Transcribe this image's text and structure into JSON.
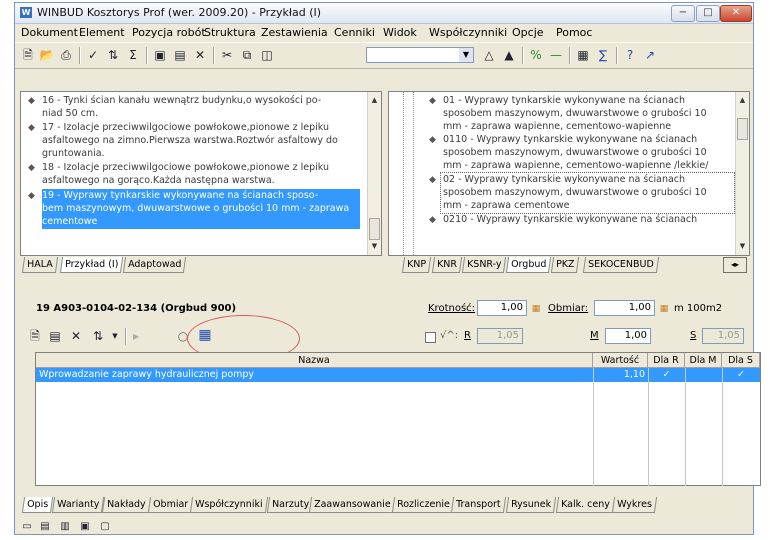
{
  "app": {
    "title": "WINBUD Kosztorys Prof (wer. 2009.20) - Przykład (I)"
  },
  "menu": [
    "Dokument",
    "Element",
    "Pozycja robót",
    "Struktura",
    "Zestawienia",
    "Cenniki",
    "Widok",
    "Współczynniki",
    "Opcje",
    "Pomoc"
  ],
  "window_controls": {
    "minimize": "−",
    "maximize": "□",
    "close": "✕"
  },
  "toolbar_icons": [
    "new-icon",
    "open-icon",
    "print-icon",
    "check-icon",
    "sort-icon",
    "sum-icon",
    "insert-icon",
    "insert-below-icon",
    "delete-icon",
    "cut-icon",
    "copy-icon",
    "paste-icon",
    "combo",
    "binoculars-icon",
    "find-next-icon",
    "percent-icon",
    "minus-icon",
    "report-icon",
    "bold-icon",
    "help-icon",
    "whatsthis-icon"
  ],
  "left_tree": {
    "items": [
      {
        "text": "16 - Tynki ścian kanału wewnątrz budynku,o wysokości po-"
      },
      {
        "text": "niad 50 cm."
      },
      {
        "text": "17 - Izolacje przeciwwilgociowe powłokowe,pionowe z lepiku"
      },
      {
        "text": "asfaltowego na zimno.Pierwsza warstwa.Roztwór asfaltowy do"
      },
      {
        "text": "gruntowania."
      },
      {
        "text": "18 - Izolacje przeciwwilgociowe powłokowe,pionowe z lepiku"
      },
      {
        "text": "asfaltowego na gorąco.Każda następna warstwa."
      },
      {
        "text": "19 - Wyprawy tynkarskie wykonywane na ścianach sposo-"
      },
      {
        "text": "bem maszynowym, dwuwarstwowe o grubości 10 mm - zaprawa"
      },
      {
        "text": "cementowe"
      }
    ],
    "tabs": [
      "HALA",
      "Przykład (I)",
      "Adaptowad"
    ]
  },
  "right_tree": {
    "items": [
      {
        "text": "01 - Wyprawy tynkarskie wykonywane na ścianach"
      },
      {
        "text": "sposobem maszynowym, dwuwarstwowe o grubości 10"
      },
      {
        "text": "mm - zaprawa wapienne, cementowo-wapienne"
      },
      {
        "text": "0110 - Wyprawy tynkarskie wykonywane na ścianach"
      },
      {
        "text": "sposobem maszynowym, dwuwarstwowe o grubości 10"
      },
      {
        "text": "mm - zaprawa wapienne, cementowo-wapienne /lekkie/"
      },
      {
        "text": "02 - Wyprawy tynkarskie wykonywane na ścianach"
      },
      {
        "text": "sposobem maszynowym, dwuwarstwowe o grubości 10"
      },
      {
        "text": "mm - zaprawa cementowe"
      },
      {
        "text": "0210 - Wyprawy tynkarskie wykonywane na ścianach"
      }
    ],
    "tabs": [
      "KNP",
      "KNR",
      "KSNR-y",
      "Orgbud",
      "PKZ",
      "SEKOCENBUD"
    ],
    "nav_button": "◂▸"
  },
  "position": {
    "line": "19  A903-0104-02-134  (Orgbud 900)",
    "krotnosc_label": "Krotność:",
    "krotnosc_value": "1,00",
    "obmiar_label": "Obmiar:",
    "obmiar_value": "1,00",
    "unit": "m 100m2",
    "flag_label": "√^:",
    "R_label": "R",
    "R_value": "1,05",
    "M_label": "M",
    "M_value": "1,00",
    "S_label": "S",
    "S_value": "1,05"
  },
  "grid": {
    "headers": [
      "Nazwa",
      "Wartość",
      "Dla R",
      "Dla M",
      "Dla S"
    ],
    "row": {
      "name": "Wprowadzanie zaprawy hydraulicznej pompy",
      "wartosc": "1,10",
      "dla_r": "✓",
      "dla_m": "",
      "dla_s": "✓"
    }
  },
  "bottom_tabs": [
    "Opis",
    "Warianty",
    "Nakłady",
    "Obmiar",
    "Współczynniki",
    "Narzuty",
    "Zaawansowanie",
    "Rozliczenie",
    "Transport",
    "Rysunek",
    "Kalk. ceny",
    "Wykres"
  ],
  "colors": {
    "selection": "#3399ff",
    "highlight_circle": "#d65c5c"
  }
}
